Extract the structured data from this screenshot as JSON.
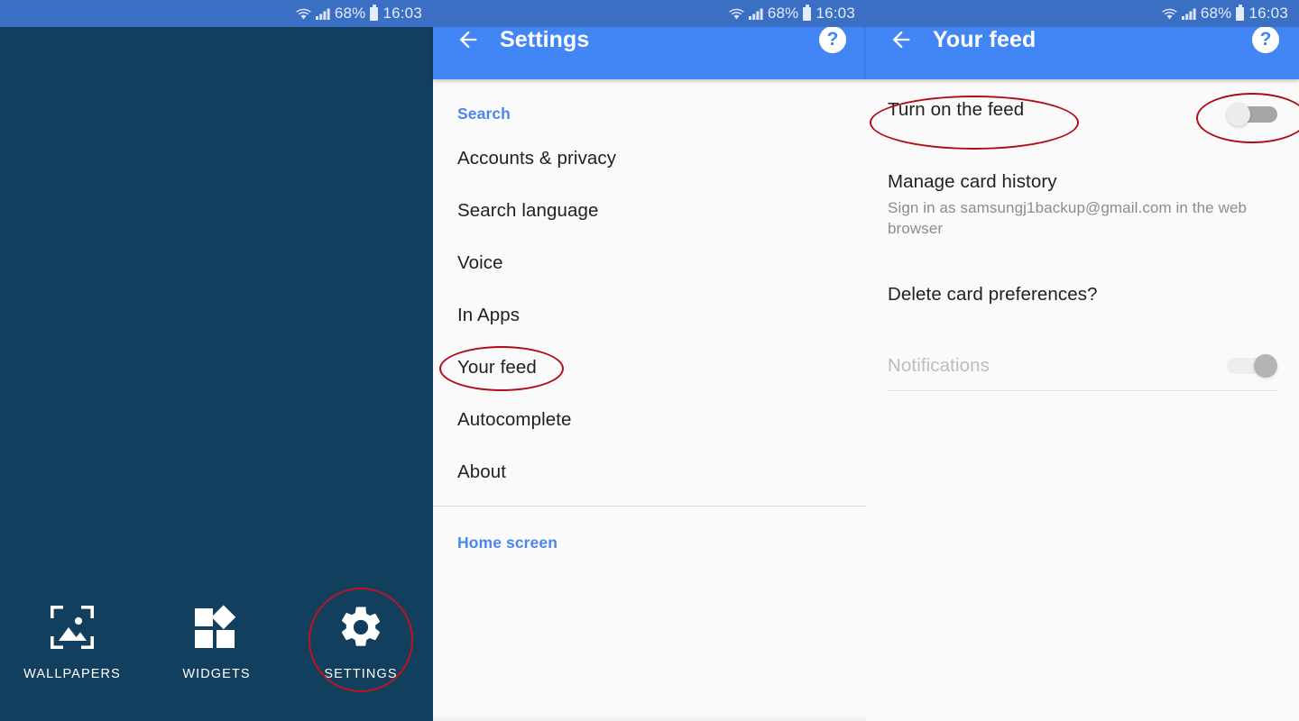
{
  "statusbar": {
    "battery_percent": "68%",
    "time": "16:03",
    "icons": [
      "wifi-icon",
      "signal-icon",
      "battery-icon"
    ]
  },
  "launcher": {
    "background_color": "#123f5e",
    "items": [
      {
        "label": "WALLPAPERS",
        "icon": "wallpapers-icon",
        "annotated": false
      },
      {
        "label": "WIDGETS",
        "icon": "widgets-icon",
        "annotated": false
      },
      {
        "label": "SETTINGS",
        "icon": "gear-icon",
        "annotated": true
      }
    ]
  },
  "settings_panel": {
    "appbar": {
      "title": "Settings",
      "back_icon": "back-arrow-icon",
      "help_icon": "help-icon",
      "accent_color": "#4285f4"
    },
    "sections": [
      {
        "header": "Search",
        "items": [
          {
            "label": "Accounts & privacy",
            "annotated": false
          },
          {
            "label": "Search language",
            "annotated": false
          },
          {
            "label": "Voice",
            "annotated": false
          },
          {
            "label": "In Apps",
            "annotated": false
          },
          {
            "label": "Your feed",
            "annotated": true
          },
          {
            "label": "Autocomplete",
            "annotated": false
          },
          {
            "label": "About",
            "annotated": false
          }
        ]
      },
      {
        "header": "Home screen",
        "items": []
      }
    ]
  },
  "feed_panel": {
    "appbar": {
      "title": "Your feed",
      "back_icon": "back-arrow-icon",
      "help_icon": "help-icon",
      "accent_color": "#4285f4"
    },
    "rows": [
      {
        "title": "Turn on the feed",
        "subtitle": "",
        "toggle": "off",
        "annotated": true
      },
      {
        "title": "Manage card history",
        "subtitle": "Sign in as samsungj1backup@gmail.com in the web browser",
        "toggle": "none",
        "annotated": false
      },
      {
        "title": "Delete card preferences?",
        "subtitle": "",
        "toggle": "none",
        "annotated": false
      },
      {
        "title": "Notifications",
        "subtitle": "",
        "toggle": "disabled",
        "annotated": false
      }
    ]
  },
  "annotation": {
    "color": "#b00d17",
    "shape": "ellipse"
  }
}
